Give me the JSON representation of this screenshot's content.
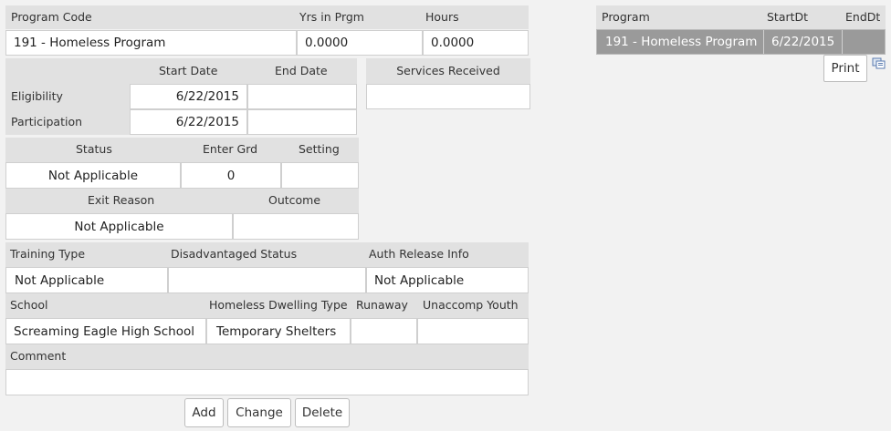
{
  "program_header": {
    "program_code_label": "Program Code",
    "yrs_label": "Yrs in Prgm",
    "hours_label": "Hours",
    "program_code_value": "191 - Homeless Program",
    "yrs_value": "0.0000",
    "hours_value": "0.0000"
  },
  "dates": {
    "start_label": "Start Date",
    "end_label": "End Date",
    "eligibility_label": "Eligibility",
    "eligibility_start": "6/22/2015",
    "eligibility_end": "",
    "participation_label": "Participation",
    "participation_start": "6/22/2015",
    "participation_end": ""
  },
  "services": {
    "label": "Services Received",
    "value": ""
  },
  "status_block": {
    "status_label": "Status",
    "enter_grd_label": "Enter Grd",
    "setting_label": "Setting",
    "status_value": "Not Applicable",
    "enter_grd_value": "0",
    "setting_value": ""
  },
  "exit_block": {
    "exit_reason_label": "Exit Reason",
    "outcome_label": "Outcome",
    "exit_reason_value": "Not Applicable",
    "outcome_value": ""
  },
  "training_block": {
    "training_type_label": "Training Type",
    "disadvantaged_label": "Disadvantaged Status",
    "auth_release_label": "Auth Release Info",
    "training_type_value": "Not Applicable",
    "disadvantaged_value": "",
    "auth_release_value": "Not Applicable"
  },
  "school_block": {
    "school_label": "School",
    "dwelling_label": "Homeless Dwelling Type",
    "runaway_label": "Runaway",
    "unaccomp_label": "Unaccomp Youth",
    "school_value": "Screaming Eagle High School",
    "dwelling_value": "Temporary Shelters",
    "runaway_value": "",
    "unaccomp_value": ""
  },
  "comment_block": {
    "label": "Comment",
    "value": ""
  },
  "actions": {
    "add": "Add",
    "change": "Change",
    "delete": "Delete"
  },
  "program_list": {
    "columns": [
      "Program",
      "StartDt",
      "EndDt"
    ],
    "rows": [
      {
        "program": "191 - Homeless Program",
        "start": "6/22/2015",
        "end": ""
      }
    ],
    "print_label": "Print",
    "copy_icon": "copy-icon"
  }
}
